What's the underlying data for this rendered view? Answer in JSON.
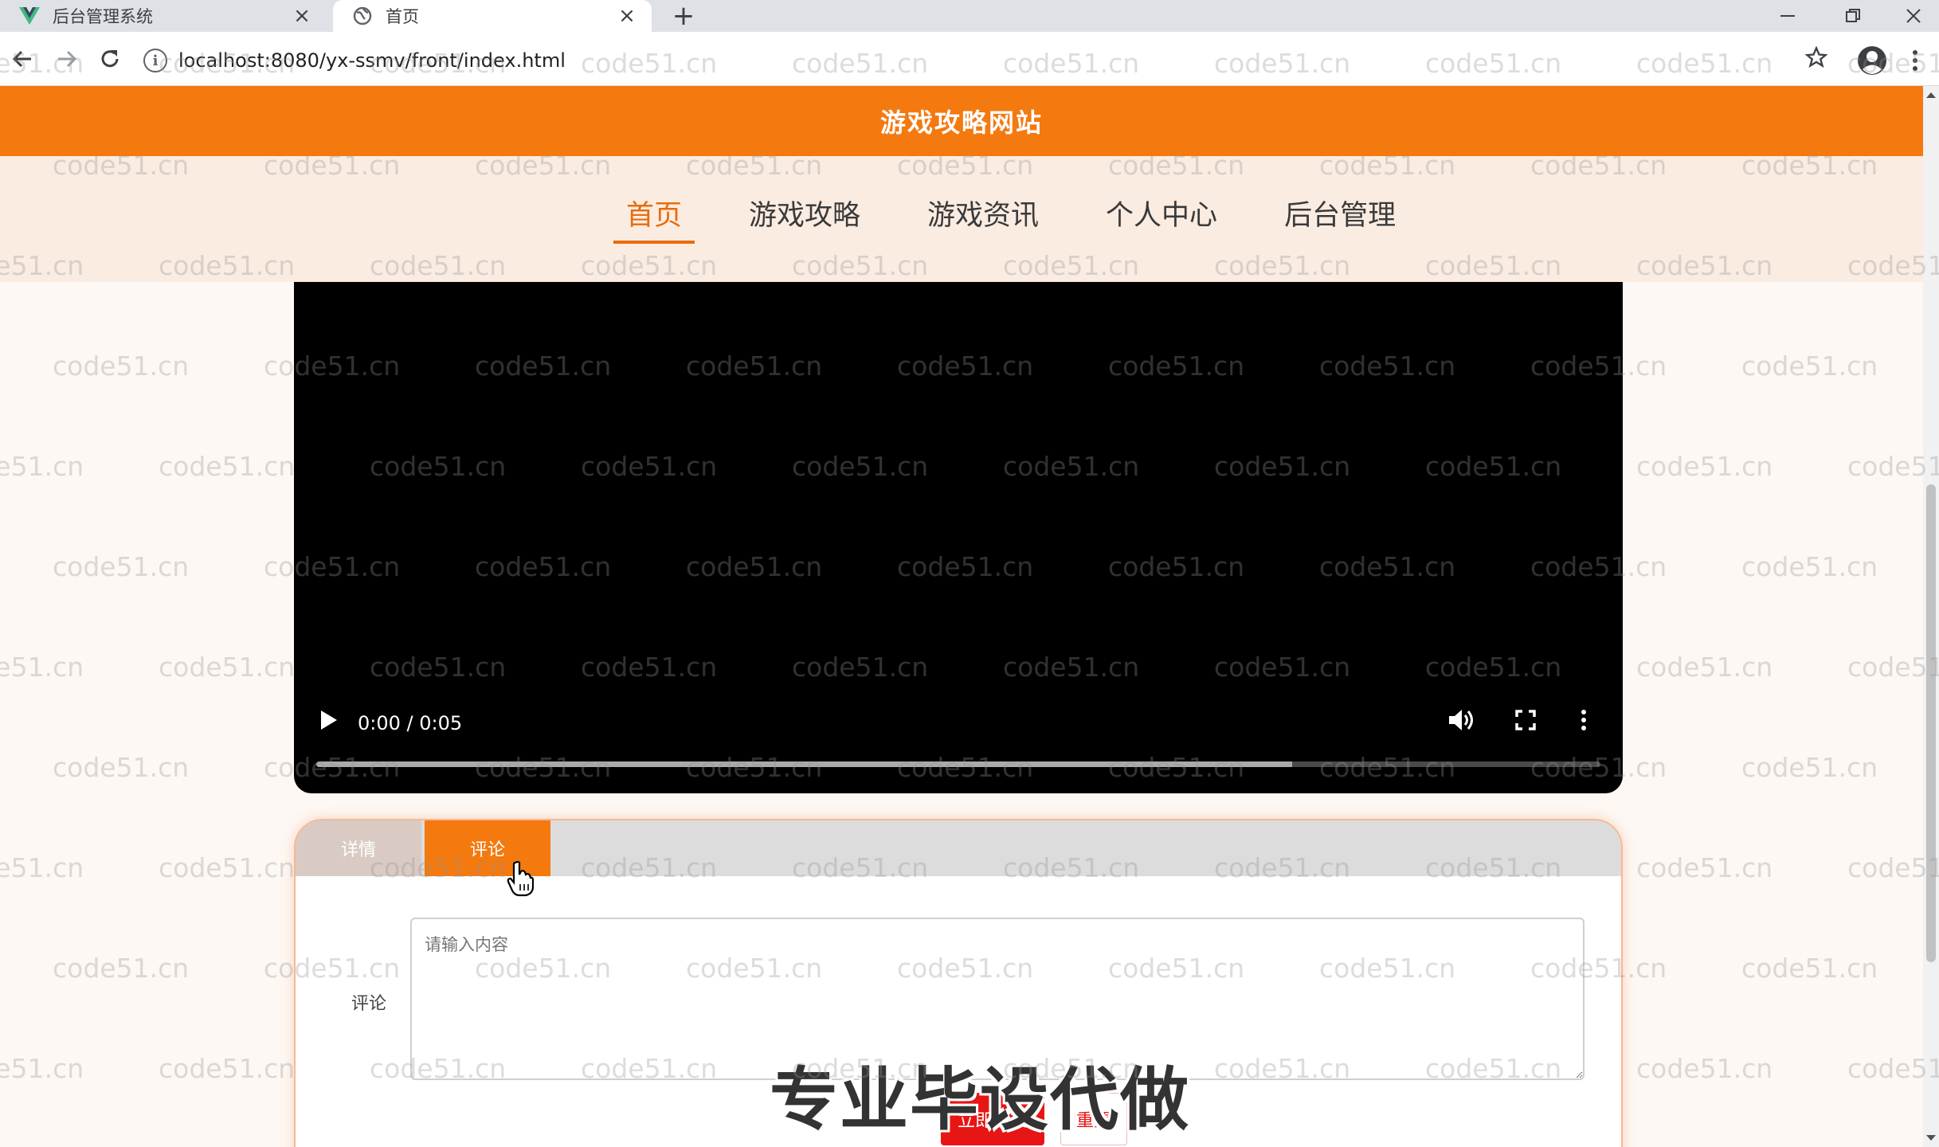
{
  "browser": {
    "tabs": [
      {
        "title": "后台管理系统",
        "icon": "vue-logo-icon",
        "active": false
      },
      {
        "title": "首页",
        "icon": "globe-icon",
        "active": true
      }
    ],
    "url": "localhost:8080/yx-ssmv/front/index.html"
  },
  "site": {
    "title": "游戏攻略网站",
    "nav": [
      "首页",
      "游戏攻略",
      "游戏资讯",
      "个人中心",
      "后台管理"
    ],
    "active_nav": "首页"
  },
  "video": {
    "time": "0:00 / 0:05",
    "progress": 0,
    "buffered": 0.76
  },
  "detail_tabs": [
    "详情",
    "评论"
  ],
  "active_detail_tab": "评论",
  "comment_form": {
    "label": "评论",
    "placeholder": "请输入内容",
    "value": "",
    "submit": "立即提交",
    "reset": "重置"
  },
  "overlay_text": "专业毕设代做",
  "watermark": "code51.cn",
  "colors": {
    "brand": "#f4790f",
    "nav_active": "#e86c0c",
    "submit": "#e81515"
  }
}
